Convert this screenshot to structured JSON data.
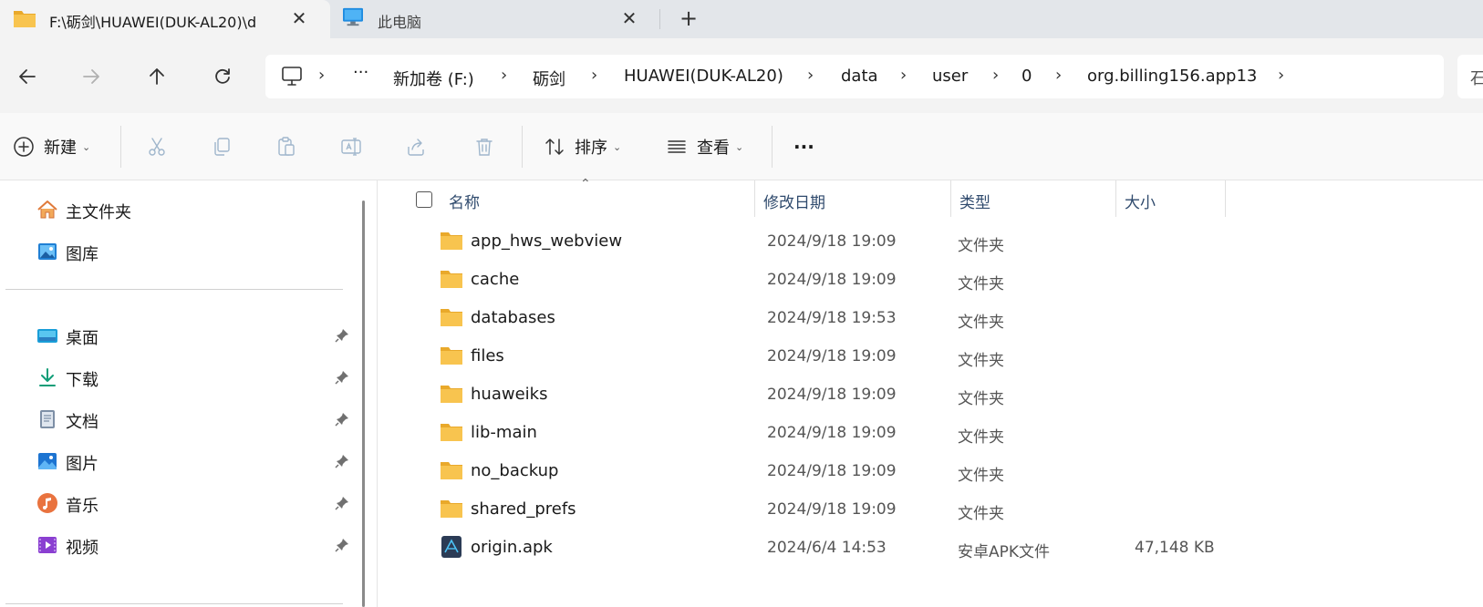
{
  "tabs": [
    {
      "title": "F:\\砺剑\\HUAWEI(DUK-AL20)\\d",
      "icon": "folder-icon",
      "active": true
    },
    {
      "title": "此电脑",
      "icon": "computer-icon",
      "active": false
    }
  ],
  "new_tab_label": "+",
  "close_glyph": "✕",
  "address": {
    "overflow": "···",
    "crumbs": [
      "新加卷 (F:)",
      "砺剑",
      "HUAWEI(DUK-AL20)",
      "data",
      "user",
      "0",
      "org.billing156.app13"
    ],
    "separator": "›"
  },
  "search_stub": "石",
  "commands": {
    "new_label": "新建",
    "sort_label": "排序",
    "view_label": "查看",
    "more_label": "···",
    "caret": "⌄"
  },
  "sidebar": {
    "top_items": [
      {
        "label": "主文件夹",
        "icon": "home-icon"
      },
      {
        "label": "图库",
        "icon": "gallery-icon"
      }
    ],
    "pinned_items": [
      {
        "label": "桌面",
        "icon": "desktop-icon"
      },
      {
        "label": "下载",
        "icon": "download-icon"
      },
      {
        "label": "文档",
        "icon": "documents-icon"
      },
      {
        "label": "图片",
        "icon": "pictures-icon"
      },
      {
        "label": "音乐",
        "icon": "music-icon"
      },
      {
        "label": "视频",
        "icon": "videos-icon"
      }
    ]
  },
  "columns": {
    "name": "名称",
    "modified": "修改日期",
    "type": "类型",
    "size": "大小"
  },
  "files": [
    {
      "name": "app_hws_webview",
      "modified": "2024/9/18 19:09",
      "type": "文件夹",
      "size": "",
      "icon": "folder-icon"
    },
    {
      "name": "cache",
      "modified": "2024/9/18 19:09",
      "type": "文件夹",
      "size": "",
      "icon": "folder-icon"
    },
    {
      "name": "databases",
      "modified": "2024/9/18 19:53",
      "type": "文件夹",
      "size": "",
      "icon": "folder-icon"
    },
    {
      "name": "files",
      "modified": "2024/9/18 19:09",
      "type": "文件夹",
      "size": "",
      "icon": "folder-icon"
    },
    {
      "name": "huaweiks",
      "modified": "2024/9/18 19:09",
      "type": "文件夹",
      "size": "",
      "icon": "folder-icon"
    },
    {
      "name": "lib-main",
      "modified": "2024/9/18 19:09",
      "type": "文件夹",
      "size": "",
      "icon": "folder-icon"
    },
    {
      "name": "no_backup",
      "modified": "2024/9/18 19:09",
      "type": "文件夹",
      "size": "",
      "icon": "folder-icon"
    },
    {
      "name": "shared_prefs",
      "modified": "2024/9/18 19:09",
      "type": "文件夹",
      "size": "",
      "icon": "folder-icon"
    },
    {
      "name": "origin.apk",
      "modified": "2024/6/4 14:53",
      "type": "安卓APK文件",
      "size": "47,148 KB",
      "icon": "apk-file-icon"
    }
  ],
  "colors": {
    "folder": "#f5c242",
    "accent": "#0067c0",
    "header_text": "#2f4a6d"
  }
}
